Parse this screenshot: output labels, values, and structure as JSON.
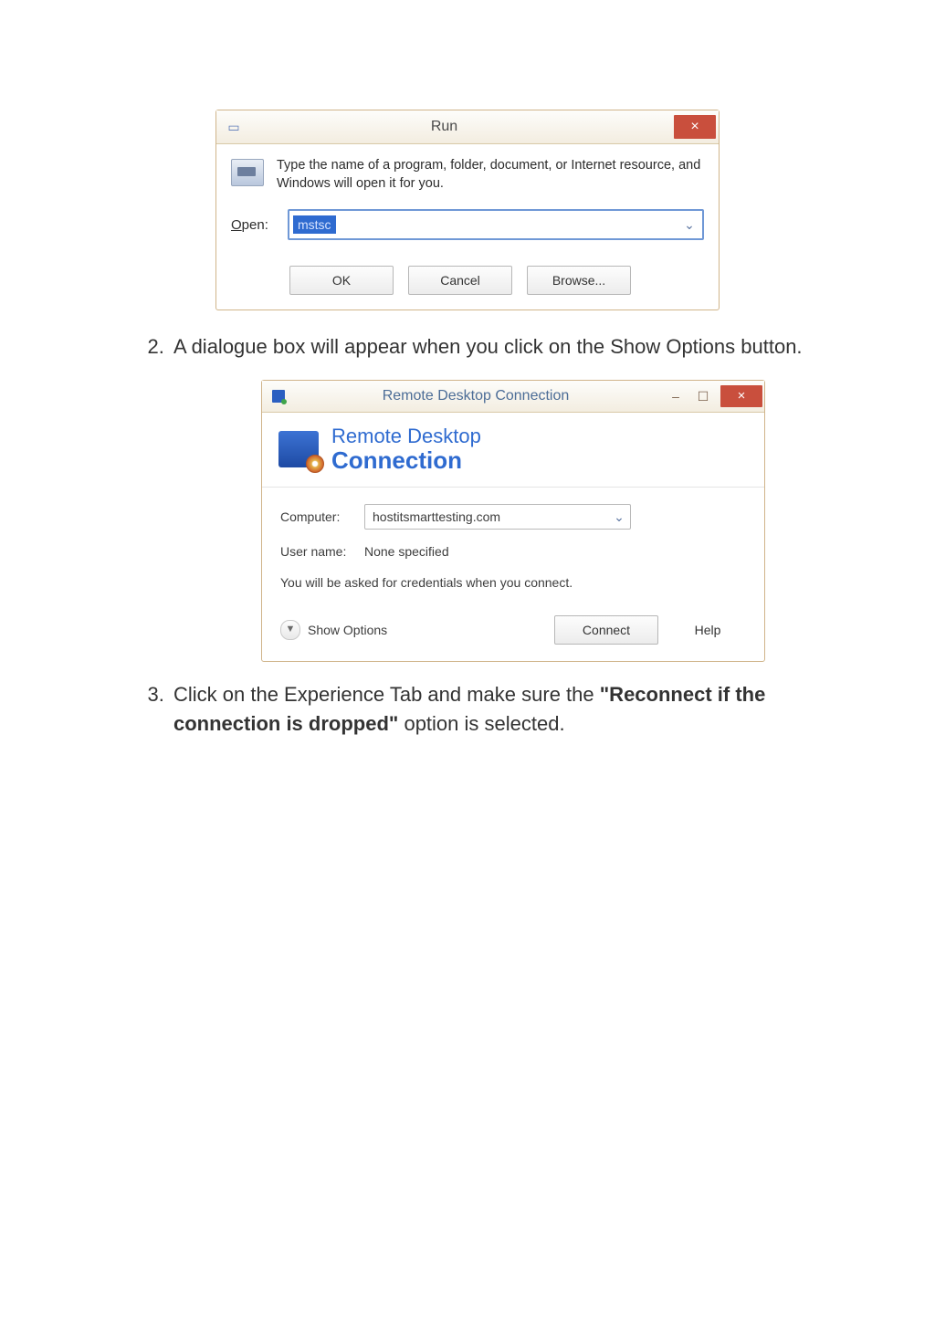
{
  "run": {
    "title": "Run",
    "message": "Type the name of a program, folder, document, or Internet resource, and Windows will open it for you.",
    "open_label": "Open:",
    "open_value": "mstsc",
    "ok": "OK",
    "cancel": "Cancel",
    "browse": "Browse...",
    "close_symbol": "×",
    "dropdown_symbol": "⌄"
  },
  "step2": {
    "text": "A dialogue box will appear when you click on the Show Options button."
  },
  "rdc": {
    "title": "Remote Desktop Connection",
    "banner_line1": "Remote Desktop",
    "banner_line2": "Connection",
    "computer_label": "Computer:",
    "computer_value": "hostitsmarttesting.com",
    "username_label": "User name:",
    "username_value": "None specified",
    "note": "You will be asked for credentials when you connect.",
    "show_options": "Show Options",
    "connect": "Connect",
    "help": "Help",
    "min": "–",
    "max": "☐",
    "close": "×",
    "chev": "▼",
    "dropdown_symbol": "⌄"
  },
  "step3": {
    "prefix": "Click on the Experience Tab and make sure the ",
    "bold": "\"Reconnect if the connection is dropped\"",
    "suffix": " option is selected."
  }
}
